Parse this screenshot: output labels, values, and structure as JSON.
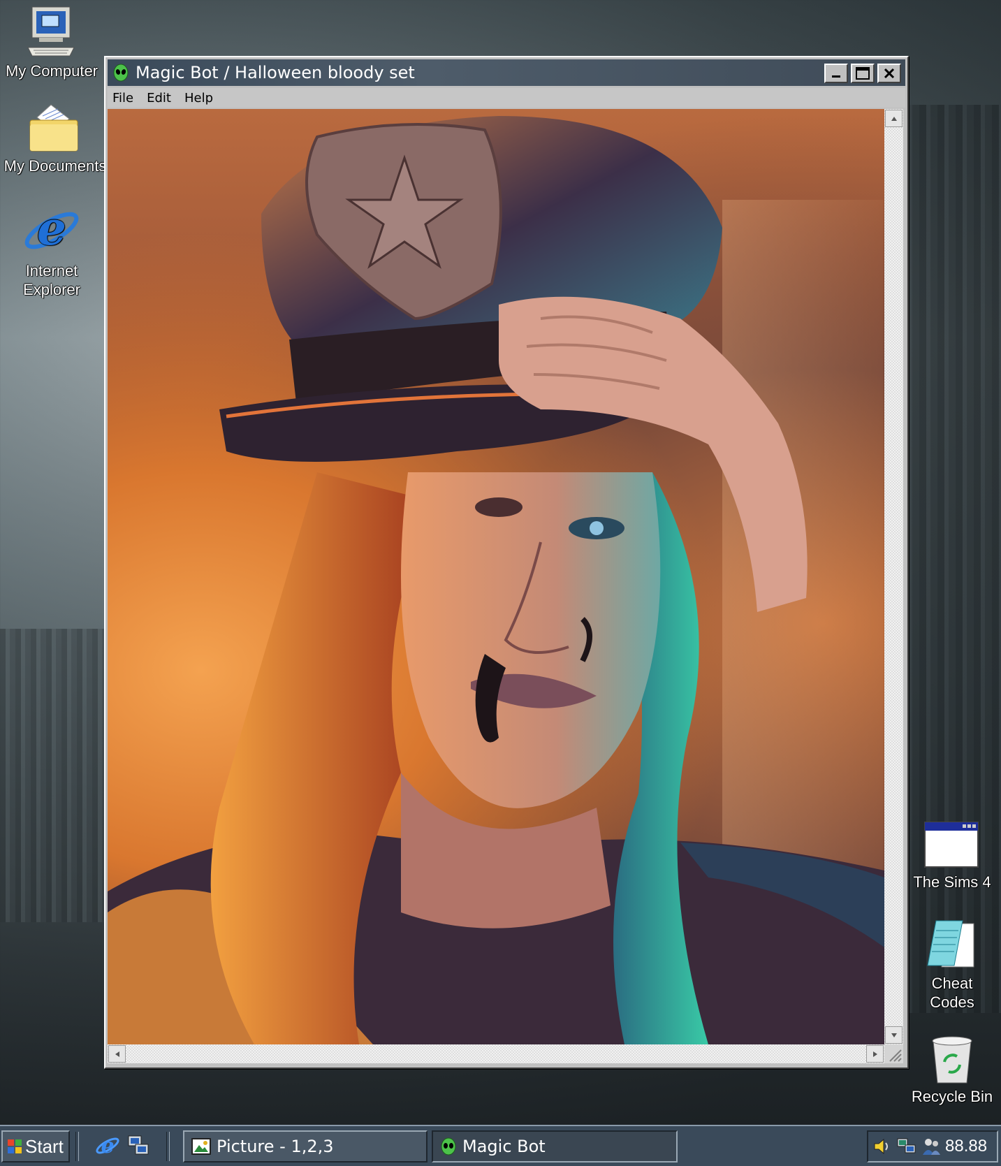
{
  "desktop": {
    "icons": {
      "my_computer": "My Computer",
      "my_documents": "My Documents",
      "internet_explorer_line1": "Internet",
      "internet_explorer_line2": "Explorer",
      "sims": "The Sims 4",
      "cheat_line1": "Cheat",
      "cheat_line2": "Codes",
      "recycle_bin": "Recycle Bin"
    }
  },
  "window": {
    "title": "Magic Bot / Halloween bloody set",
    "menu": [
      "File",
      "Edit",
      "Help"
    ],
    "content_icon": "picture-of-woman-in-police-hat"
  },
  "taskbar": {
    "start_label": "Start",
    "tasks": [
      {
        "label": "Picture - 1,2,3",
        "icon": "picture-icon",
        "active": false
      },
      {
        "label": "Magic Bot",
        "icon": "alien-icon",
        "active": true
      }
    ],
    "clock": "88.88"
  },
  "colors": {
    "titlebar": "#3a4a5a",
    "window_face": "#c0c0c0",
    "taskbar": "#3a4a5a"
  }
}
